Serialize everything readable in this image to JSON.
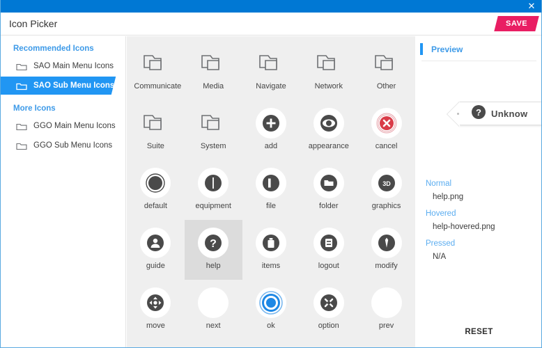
{
  "titlebar": {
    "close_icon": "close-icon"
  },
  "header": {
    "title": "Icon Picker",
    "save_label": "SAVE"
  },
  "colors": {
    "titlebar_blue": "#0078d4",
    "accent_blue": "#2196f3",
    "link_blue": "#3d9ae8",
    "save_pink": "#e91e63",
    "grid_bg": "#efefef",
    "selected_cell": "#dcdcdc",
    "glyph_dark": "#4a4a4a",
    "cancel_red": "#d93b48"
  },
  "sidebar": {
    "sections": [
      {
        "title": "Recommended Icons",
        "items": [
          {
            "label": "SAO Main Menu Icons",
            "selected": false
          },
          {
            "label": "SAO Sub Menu Icons",
            "selected": true
          }
        ]
      },
      {
        "title": "More Icons",
        "items": [
          {
            "label": "GGO Main Menu Icons",
            "selected": false
          },
          {
            "label": "GGO Sub Menu Icons",
            "selected": false
          }
        ]
      }
    ]
  },
  "grid": {
    "items": [
      {
        "label": "Communicate",
        "icon": "folder-outline-icon",
        "kind": "folder",
        "selected": false
      },
      {
        "label": "Media",
        "icon": "folder-outline-icon",
        "kind": "folder",
        "selected": false
      },
      {
        "label": "Navigate",
        "icon": "folder-outline-icon",
        "kind": "folder",
        "selected": false
      },
      {
        "label": "Network",
        "icon": "folder-outline-icon",
        "kind": "folder",
        "selected": false
      },
      {
        "label": "Other",
        "icon": "folder-outline-icon",
        "kind": "folder",
        "selected": false
      },
      {
        "label": "Suite",
        "icon": "folder-outline-icon",
        "kind": "folder",
        "selected": false
      },
      {
        "label": "System",
        "icon": "folder-outline-icon",
        "kind": "folder",
        "selected": false
      },
      {
        "label": "add",
        "icon": "plus-circle-icon",
        "kind": "circle",
        "selected": false
      },
      {
        "label": "appearance",
        "icon": "eye-icon",
        "kind": "circle",
        "selected": false
      },
      {
        "label": "cancel",
        "icon": "cancel-x-icon",
        "kind": "circle",
        "selected": false
      },
      {
        "label": "default",
        "icon": "default-ring-icon",
        "kind": "circle",
        "selected": false
      },
      {
        "label": "equipment",
        "icon": "equipment-icon",
        "kind": "circle",
        "selected": false
      },
      {
        "label": "file",
        "icon": "file-icon",
        "kind": "circle",
        "selected": false
      },
      {
        "label": "folder",
        "icon": "folder-solid-icon",
        "kind": "circle",
        "selected": false
      },
      {
        "label": "graphics",
        "icon": "graphics-3d-icon",
        "kind": "circle",
        "selected": false
      },
      {
        "label": "guide",
        "icon": "guide-person-icon",
        "kind": "circle",
        "selected": false
      },
      {
        "label": "help",
        "icon": "question-mark-icon",
        "kind": "circle",
        "selected": true
      },
      {
        "label": "items",
        "icon": "items-bag-icon",
        "kind": "circle",
        "selected": false
      },
      {
        "label": "logout",
        "icon": "logout-icon",
        "kind": "circle",
        "selected": false
      },
      {
        "label": "modify",
        "icon": "modify-pen-icon",
        "kind": "circle",
        "selected": false
      },
      {
        "label": "move",
        "icon": "move-arrows-icon",
        "kind": "circle",
        "selected": false
      },
      {
        "label": "next",
        "icon": "blank-icon",
        "kind": "circle",
        "selected": false
      },
      {
        "label": "ok",
        "icon": "ok-target-icon",
        "kind": "circle",
        "selected": false
      },
      {
        "label": "option",
        "icon": "option-tools-icon",
        "kind": "circle",
        "selected": false
      },
      {
        "label": "prev",
        "icon": "blank-icon",
        "kind": "circle",
        "selected": false
      }
    ]
  },
  "preview": {
    "title": "Preview",
    "tag_text": "Unknow",
    "tag_icon": "question-mark-icon",
    "states": [
      {
        "key": "Normal",
        "value": "help.png"
      },
      {
        "key": "Hovered",
        "value": "help-hovered.png"
      },
      {
        "key": "Pressed",
        "value": "N/A"
      }
    ],
    "reset_label": "RESET"
  }
}
